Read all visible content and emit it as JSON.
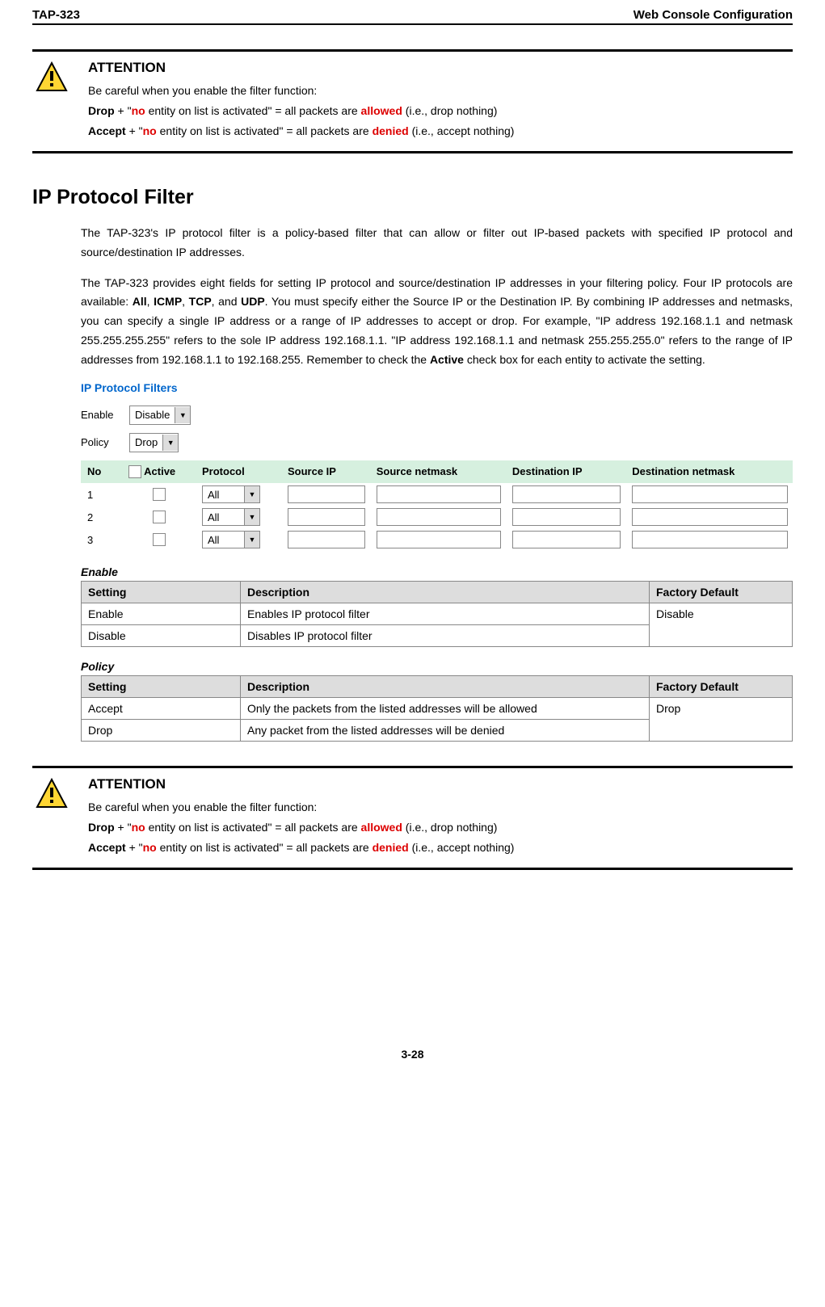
{
  "header": {
    "left": "TAP-323",
    "right": "Web Console Configuration"
  },
  "attention": {
    "title": "ATTENTION",
    "careful": "Be careful when you enable the filter function:",
    "drop_word": "Drop",
    "accept_word": "Accept",
    "plus_open": " + \"",
    "no_word": "no",
    "entity_text": " entity on list is activated\" = all packets are ",
    "allowed": "allowed",
    "denied": "denied",
    "drop_tail": " (i.e., drop nothing)",
    "accept_tail": " (i.e., accept nothing)"
  },
  "section_title": "IP Protocol Filter",
  "paragraph1": "The TAP-323's IP protocol filter is a policy-based filter that can allow or filter out IP-based packets with specified IP protocol and source/destination IP addresses.",
  "paragraph2_a": "The TAP-323 provides eight fields for setting IP protocol and source/destination IP addresses in your filtering policy. Four IP protocols are available: ",
  "p2_all": "All",
  "p2_sep1": ", ",
  "p2_icmp": "ICMP",
  "p2_sep2": ", ",
  "p2_tcp": "TCP",
  "p2_sep3": ", and ",
  "p2_udp": "UDP",
  "paragraph2_b": ". You must specify either the Source IP or the Destination IP. By combining IP addresses and netmasks, you can specify a single IP address or a range of IP addresses to accept or drop. For example, \"IP address 192.168.1.1 and netmask 255.255.255.255\" refers to the sole IP address 192.168.1.1. \"IP address 192.168.1.1 and netmask 255.255.255.0\" refers to the range of IP addresses from 192.168.1.1 to 192.168.255. Remember to check the ",
  "p2_active": "Active",
  "paragraph2_c": " check box for each entity to activate the setting.",
  "screenshot": {
    "title": "IP Protocol Filters",
    "enable_label": "Enable",
    "enable_value": "Disable",
    "policy_label": "Policy",
    "policy_value": "Drop",
    "headers": {
      "no": "No",
      "active": "Active",
      "protocol": "Protocol",
      "src_ip": "Source IP",
      "src_mask": "Source netmask",
      "dst_ip": "Destination IP",
      "dst_mask": "Destination netmask"
    },
    "proto_default": "All",
    "rows": [
      "1",
      "2",
      "3"
    ]
  },
  "enable_table": {
    "title": "Enable",
    "h_setting": "Setting",
    "h_desc": "Description",
    "h_def": "Factory Default",
    "r1_s": "Enable",
    "r1_d": "Enables IP protocol filter",
    "r2_s": "Disable",
    "r2_d": "Disables IP protocol filter",
    "default": "Disable"
  },
  "policy_table": {
    "title": "Policy",
    "h_setting": "Setting",
    "h_desc": "Description",
    "h_def": "Factory Default",
    "r1_s": "Accept",
    "r1_d": "Only the packets from the listed addresses will be allowed",
    "r2_s": "Drop",
    "r2_d": "Any packet from the listed addresses will be denied",
    "default": "Drop"
  },
  "page_number": "3-28"
}
